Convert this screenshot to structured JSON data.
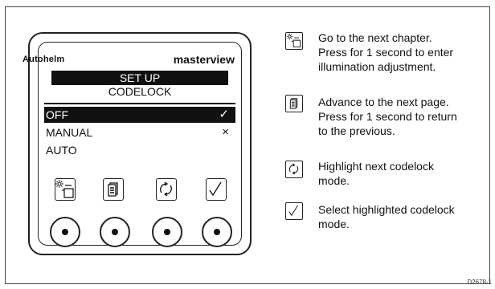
{
  "device": {
    "brand": "Autohelm",
    "model": "masterview",
    "screen": {
      "title": "SET UP",
      "subtitle": "CODELOCK",
      "modes": [
        {
          "label": "OFF",
          "status": "✓",
          "selected": true
        },
        {
          "label": "MANUAL",
          "status": "×",
          "selected": false
        },
        {
          "label": "AUTO",
          "status": "",
          "selected": false
        }
      ]
    },
    "keys": [
      {
        "icon": "chapter-icon"
      },
      {
        "icon": "page-icon"
      },
      {
        "icon": "cycle-icon"
      },
      {
        "icon": "check-icon"
      }
    ]
  },
  "legend": [
    {
      "icon": "chapter-icon",
      "lines": [
        "Go to the next chapter.",
        "Press for 1 second to enter",
        "illumination adjustment."
      ]
    },
    {
      "icon": "page-icon",
      "lines": [
        "Advance to the next page.",
        "Press for 1 second to return",
        "to the previous."
      ]
    },
    {
      "icon": "cycle-icon",
      "lines": [
        "Highlight next codelock",
        "mode."
      ]
    },
    {
      "icon": "check-icon",
      "lines": [
        "Select highlighted codelock",
        "mode."
      ]
    }
  ],
  "figure_code": "D2678-1"
}
